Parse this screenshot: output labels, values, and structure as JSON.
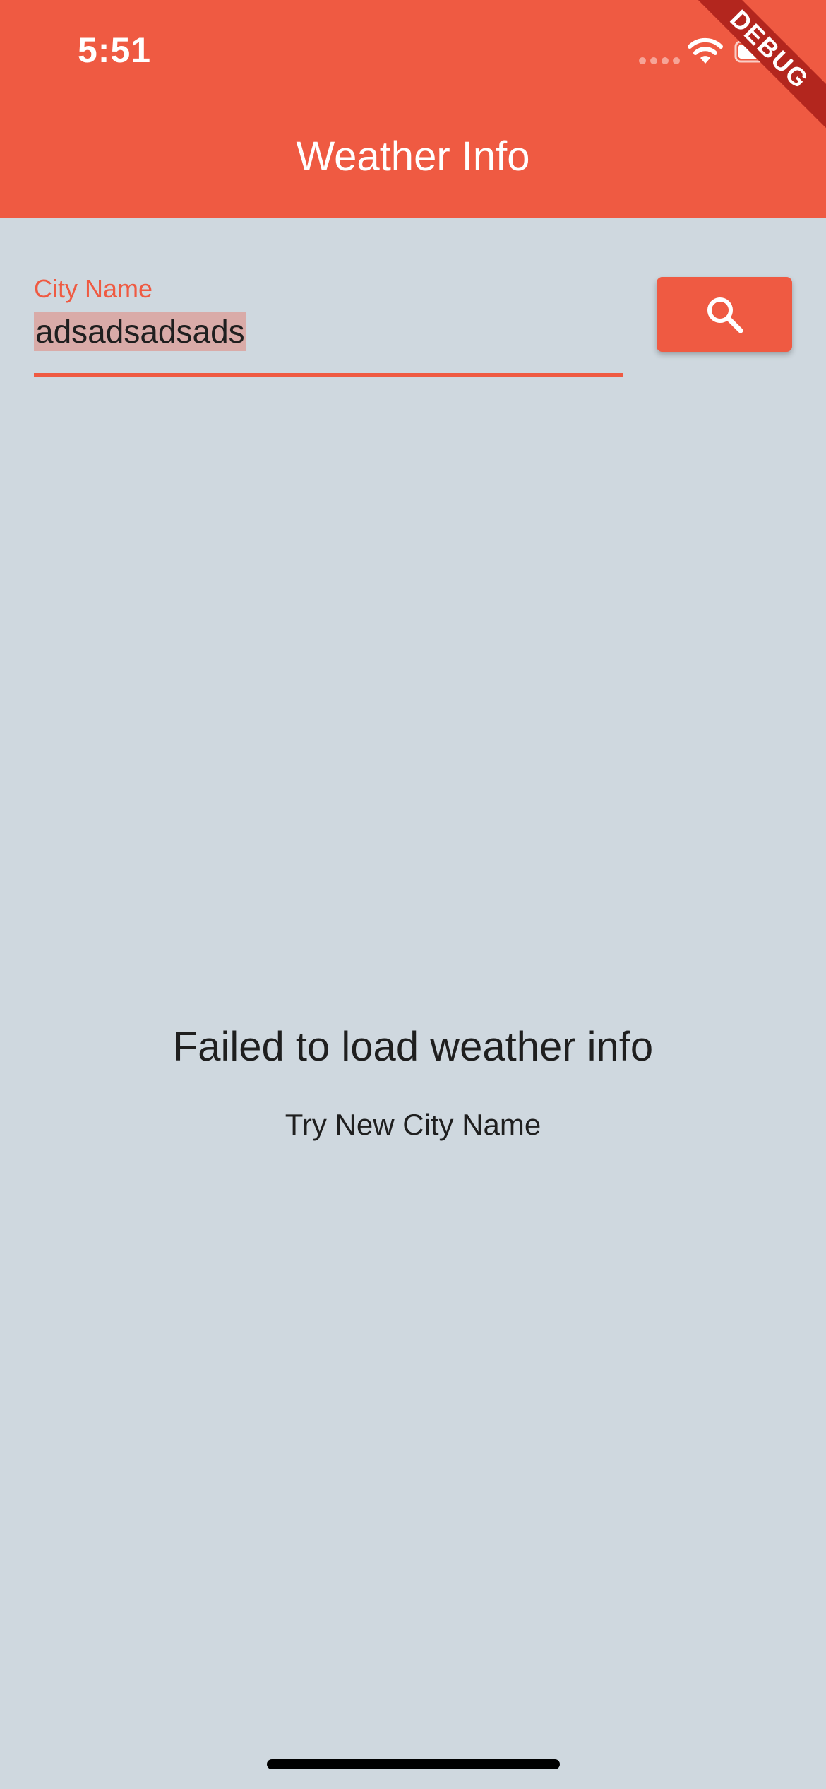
{
  "status_bar": {
    "time": "5:51",
    "icons": [
      "signal-dots-icon",
      "wifi-icon",
      "battery-icon"
    ]
  },
  "debug_banner": {
    "label": "DEBUG"
  },
  "app_bar": {
    "title": "Weather Info",
    "color": "#ef5a42"
  },
  "search": {
    "label": "City Name",
    "value": "adsadsadsads",
    "button_icon": "search-icon"
  },
  "message": {
    "title": "Failed to load weather info",
    "subtitle": "Try New City Name"
  },
  "colors": {
    "accent": "#ef5a42",
    "background": "#cfd8df",
    "text": "#1f1f1f",
    "selection": "#d9aba8"
  }
}
